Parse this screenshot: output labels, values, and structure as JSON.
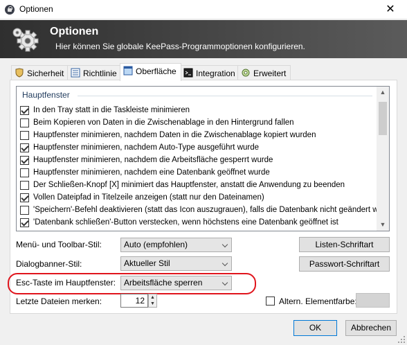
{
  "window": {
    "title": "Optionen",
    "close_glyph": "✕"
  },
  "banner": {
    "title": "Optionen",
    "subtitle": "Hier können Sie globale KeePass-Programmoptionen konfigurieren.",
    "icon": "gears-icon"
  },
  "tabs": [
    {
      "label": "Sicherheit",
      "icon": "shield-icon"
    },
    {
      "label": "Richtlinie",
      "icon": "list-icon"
    },
    {
      "label": "Oberfläche",
      "icon": "window-icon",
      "active": true
    },
    {
      "label": "Integration",
      "icon": "terminal-icon"
    },
    {
      "label": "Erweitert",
      "icon": "advanced-icon"
    }
  ],
  "main_window_group": {
    "heading": "Hauptfenster",
    "items": [
      {
        "label": "In den Tray statt in die Taskleiste minimieren",
        "checked": true
      },
      {
        "label": "Beim Kopieren von Daten in die Zwischenablage in den Hintergrund fallen",
        "checked": false
      },
      {
        "label": "Hauptfenster minimieren, nachdem Daten in die Zwischenablage kopiert wurden",
        "checked": false
      },
      {
        "label": "Hauptfenster minimieren, nachdem Auto-Type ausgeführt wurde",
        "checked": true
      },
      {
        "label": "Hauptfenster minimieren, nachdem die Arbeitsfläche gesperrt wurde",
        "checked": true
      },
      {
        "label": "Hauptfenster minimieren, nachdem eine Datenbank geöffnet wurde",
        "checked": false
      },
      {
        "label": "Der Schließen-Knopf [X] minimiert das Hauptfenster, anstatt die Anwendung zu beenden",
        "checked": false
      },
      {
        "label": "Vollen Dateipfad in Titelzeile anzeigen (statt nur den Dateinamen)",
        "checked": true
      },
      {
        "label": "'Speichern'-Befehl deaktivieren (statt das Icon auszugrauen), falls die Datenbank nicht geändert wurde",
        "checked": false
      },
      {
        "label": "'Datenbank schließen'-Button verstecken, wenn höchstens eine Datenbank geöffnet ist",
        "checked": true
      }
    ]
  },
  "settings": {
    "menu_style": {
      "label": "Menü- und Toolbar-Stil:",
      "value": "Auto (empfohlen)"
    },
    "banner_style": {
      "label": "Dialogbanner-Stil:",
      "value": "Aktueller Stil"
    },
    "esc_key": {
      "label": "Esc-Taste im Hauptfenster:",
      "value": "Arbeitsfläche sperren"
    },
    "recent_files": {
      "label": "Letzte Dateien merken:",
      "value": "12"
    },
    "list_font_button": "Listen-Schriftart",
    "password_font_button": "Passwort-Schriftart",
    "alt_color": {
      "label": "Altern. Elementfarbe:",
      "checked": false,
      "color": "#d4d4d4"
    }
  },
  "footer": {
    "ok": "OK",
    "cancel": "Abbrechen"
  },
  "colors": {
    "highlight_outline": "#e0141c",
    "banner_dark": "#2f2f2f",
    "group_heading": "#1e395b"
  }
}
